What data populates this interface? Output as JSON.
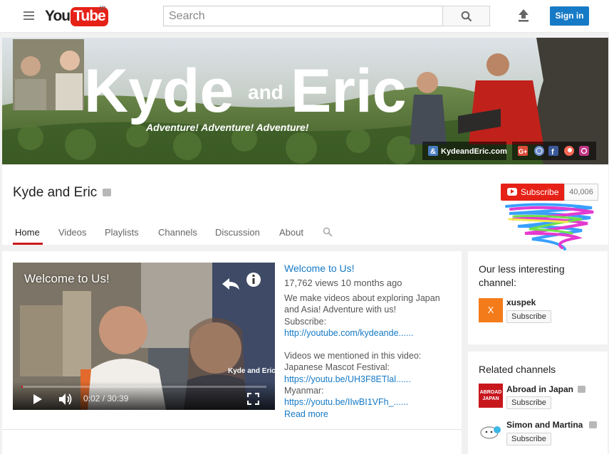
{
  "masthead": {
    "logo_you": "You",
    "logo_tube": "Tube",
    "logo_region": "JP",
    "search_placeholder": "Search",
    "signin_label": "Sign in"
  },
  "banner": {
    "title_left": "Kyde",
    "title_and": "and",
    "title_right": "Eric",
    "tagline": "Adventure! Adventure! Adventure!",
    "site_link": "KydeandEric.com",
    "social_icons": [
      "google-plus-icon",
      "globe-icon",
      "facebook-icon",
      "patreon-icon",
      "instagram-icon"
    ]
  },
  "channel": {
    "title": "Kyde and Eric",
    "subscribe_label": "Subscribe",
    "subscriber_count": "40,006"
  },
  "tabs": [
    "Home",
    "Videos",
    "Playlists",
    "Channels",
    "Discussion",
    "About"
  ],
  "feature": {
    "overlay_title": "Welcome to Us!",
    "video_title": "Welcome to Us!",
    "meta": "17,762 views  10 months ago",
    "watermark": "Kyde and Eric",
    "time": "0:02 / 30:39",
    "progress_fraction": 0.001,
    "description": [
      {
        "text": "We make videos about exploring Japan",
        "link": false
      },
      {
        "text": "and Asia! Adventure with us!",
        "link": false
      },
      {
        "text": "Subscribe:",
        "link": false
      },
      {
        "text": "http://youtube.com/kydeande......",
        "link": true
      },
      {
        "text": "",
        "link": false
      },
      {
        "text": "Videos we mentioned in this video:",
        "link": false
      },
      {
        "text": "Japanese Mascot Festival:",
        "link": false
      },
      {
        "text": "https://youtu.be/UH3F8ETlal......",
        "link": true
      },
      {
        "text": "Myanmar:",
        "link": false
      },
      {
        "text": "https://youtu.be/IIwBI1VFh_......",
        "link": true
      }
    ],
    "read_more": "Read more"
  },
  "sidebar": {
    "card1": {
      "heading": "Our less interesting channel:",
      "channel_name": "xuspek",
      "avatar_letter": "X",
      "subscribe_label": "Subscribe"
    },
    "card2": {
      "heading": "Related channels",
      "channels": [
        {
          "name": "Abroad in Japan",
          "subscribe_label": "Subscribe",
          "avatar_text": "ABROAD JAPAN"
        },
        {
          "name": "Simon and Martina",
          "subscribe_label": "Subscribe"
        }
      ]
    }
  },
  "colors": {
    "brand_red": "#e62117",
    "link_blue": "#167ac6",
    "signin_blue": "#167ac6"
  }
}
